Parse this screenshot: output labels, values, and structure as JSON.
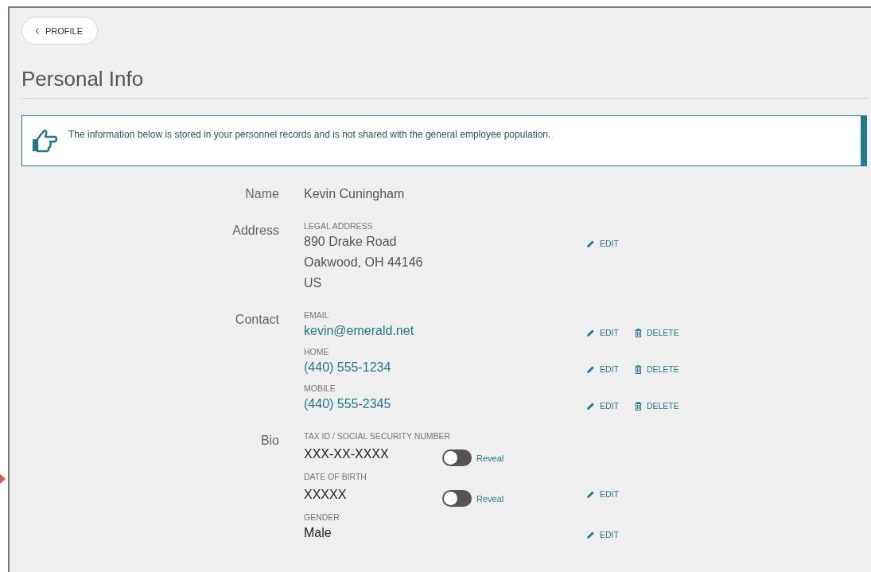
{
  "back_button": {
    "label": "PROFILE"
  },
  "title": "Personal Info",
  "notice": {
    "text": "The information below is stored in your personnel records and is not shared with the general employee population."
  },
  "sections": [
    {
      "label": "Name",
      "entries": [
        {
          "kind": "plain",
          "lines": [
            "Kevin Cuningham"
          ]
        }
      ]
    },
    {
      "label": "Address",
      "entries": [
        {
          "kind": "plain",
          "caption": "LEGAL ADDRESS",
          "lines": [
            "890 Drake Road",
            "Oakwood, OH 44146",
            "US"
          ],
          "actions": [
            {
              "kind": "edit",
              "label": "EDIT"
            }
          ]
        }
      ]
    },
    {
      "label": "Contact",
      "entries": [
        {
          "kind": "link",
          "caption": "EMAIL",
          "lines": [
            "kevin@emerald.net"
          ],
          "actions": [
            {
              "kind": "edit",
              "label": "EDIT"
            },
            {
              "kind": "delete",
              "label": "DELETE"
            }
          ]
        },
        {
          "kind": "link",
          "caption": "HOME",
          "lines": [
            "(440) 555-1234"
          ],
          "actions": [
            {
              "kind": "edit",
              "label": "EDIT"
            },
            {
              "kind": "delete",
              "label": "DELETE"
            }
          ]
        },
        {
          "kind": "link",
          "caption": "MOBILE",
          "lines": [
            "(440) 555-2345"
          ],
          "actions": [
            {
              "kind": "edit",
              "label": "EDIT"
            },
            {
              "kind": "delete",
              "label": "DELETE"
            }
          ]
        }
      ]
    },
    {
      "label": "Bio",
      "entries": [
        {
          "kind": "masked",
          "caption": "TAX ID / SOCIAL SECURITY NUMBER",
          "lines": [
            "XXX-XX-XXXX"
          ],
          "toggle": {
            "on": false,
            "label": "Reveal"
          }
        },
        {
          "kind": "masked",
          "caption": "DATE OF BIRTH",
          "lines": [
            "XXXXX"
          ],
          "toggle": {
            "on": false,
            "label": "Reveal"
          },
          "actions": [
            {
              "kind": "edit",
              "label": "EDIT"
            }
          ]
        },
        {
          "kind": "masked",
          "caption": "GENDER",
          "lines": [
            "Male"
          ],
          "actions": [
            {
              "kind": "edit",
              "label": "EDIT"
            }
          ]
        }
      ]
    }
  ]
}
